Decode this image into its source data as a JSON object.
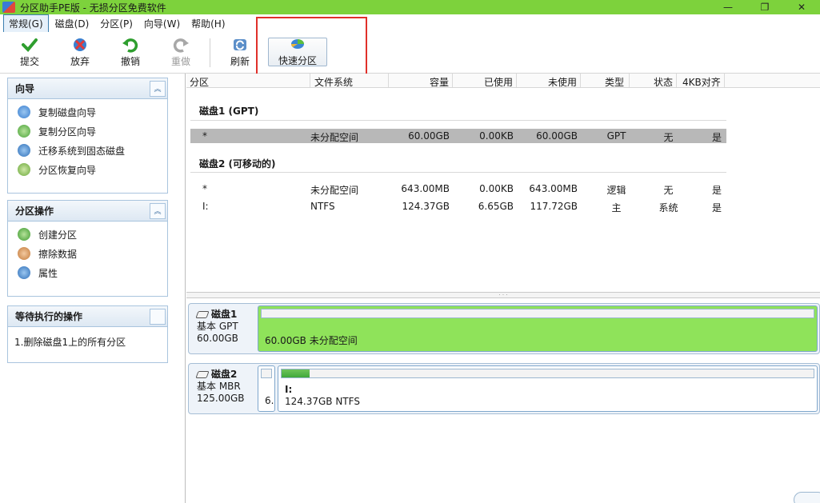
{
  "window": {
    "title": "分区助手PE版 - 无损分区免费软件",
    "minimize": "—",
    "maximize": "❐",
    "close": "✕"
  },
  "menu": [
    {
      "label": "常规(G)",
      "active": true
    },
    {
      "label": "磁盘(D)"
    },
    {
      "label": "分区(P)"
    },
    {
      "label": "向导(W)"
    },
    {
      "label": "帮助(H)"
    }
  ],
  "toolbar": {
    "commit": "提交",
    "discard": "放弃",
    "undo": "撤销",
    "redo": "重做",
    "refresh": "刷新",
    "quick_partition": "快速分区"
  },
  "wizard_panel": {
    "title": "向导",
    "items": [
      "复制磁盘向导",
      "复制分区向导",
      "迁移系统到固态磁盘",
      "分区恢复向导"
    ]
  },
  "partition_ops_panel": {
    "title": "分区操作",
    "items": [
      "创建分区",
      "擦除数据",
      "属性"
    ]
  },
  "pending_panel": {
    "title": "等待执行的操作",
    "items": [
      "1.删除磁盘1上的所有分区"
    ]
  },
  "columns": [
    "分区",
    "文件系统",
    "容量",
    "已使用",
    "未使用",
    "类型",
    "状态",
    "4KB对齐"
  ],
  "disks": [
    {
      "group_label": "磁盘1 (GPT)",
      "rows": [
        {
          "partition": "*",
          "fs": "未分配空间",
          "capacity": "60.00GB",
          "used": "0.00KB",
          "unused": "60.00GB",
          "type": "GPT",
          "status": "无",
          "align": "是",
          "selected": true
        }
      ]
    },
    {
      "group_label": "磁盘2 (可移动的)",
      "rows": [
        {
          "partition": "*",
          "fs": "未分配空间",
          "capacity": "643.00MB",
          "used": "0.00KB",
          "unused": "643.00MB",
          "type": "逻辑",
          "status": "无",
          "align": "是"
        },
        {
          "partition": "I:",
          "fs": "NTFS",
          "capacity": "124.37GB",
          "used": "6.65GB",
          "unused": "117.72GB",
          "type": "主",
          "status": "系统",
          "align": "是"
        }
      ]
    }
  ],
  "disk_map": [
    {
      "name": "磁盘1",
      "kind": "基本 GPT",
      "size": "60.00GB",
      "partitions": [
        {
          "label": "60.00GB 未分配空间"
        }
      ]
    },
    {
      "name": "磁盘2",
      "kind": "基本 MBR",
      "size": "125.00GB",
      "partitions": [
        {
          "label": "6."
        },
        {
          "drive": "I:",
          "label": "124.37GB NTFS",
          "used_fraction": 0.053
        }
      ]
    }
  ],
  "colors": {
    "title_bar": "#7dd23c",
    "unallocated_partition": "#8fe35a",
    "highlight_box": "#e0302a",
    "usage_fill": "#4fb544"
  }
}
